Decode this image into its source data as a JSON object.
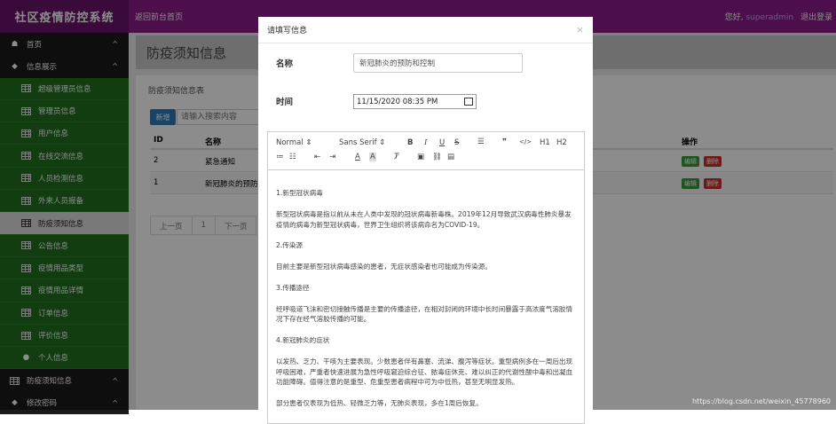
{
  "header": {
    "brand": "社区疫情防控系统",
    "home_link": "返回前台首页",
    "greeting": "您好,",
    "username": "superadmin",
    "logout": "退出登录"
  },
  "sidebar": {
    "items": [
      {
        "label": "首页",
        "type": "group",
        "icon": "home-icon",
        "chevron": "^"
      },
      {
        "label": "信息展示",
        "type": "group",
        "icon": "cubes-icon",
        "chevron": "^"
      },
      {
        "label": "超级管理员信息",
        "type": "sub",
        "icon": "table-icon"
      },
      {
        "label": "管理员信息",
        "type": "sub",
        "icon": "table-icon"
      },
      {
        "label": "用户信息",
        "type": "sub",
        "icon": "table-icon"
      },
      {
        "label": "在线交流信息",
        "type": "sub",
        "icon": "table-icon"
      },
      {
        "label": "人员检测信息",
        "type": "sub",
        "icon": "table-icon"
      },
      {
        "label": "外来人员报备",
        "type": "sub",
        "icon": "table-icon"
      },
      {
        "label": "防疫须知信息",
        "type": "sub",
        "icon": "table-icon",
        "active": true
      },
      {
        "label": "公告信息",
        "type": "sub",
        "icon": "table-icon"
      },
      {
        "label": "疫情用品类型",
        "type": "sub",
        "icon": "table-icon"
      },
      {
        "label": "疫情用品详情",
        "type": "sub",
        "icon": "table-icon"
      },
      {
        "label": "订单信息",
        "type": "sub",
        "icon": "table-icon"
      },
      {
        "label": "评价信息",
        "type": "sub",
        "icon": "table-icon"
      },
      {
        "label": "个人信息",
        "type": "sub",
        "icon": "user-icon"
      },
      {
        "label": "防疫须知信息",
        "type": "group",
        "icon": "table-icon",
        "chevron": "^"
      },
      {
        "label": "修改密码",
        "type": "group",
        "icon": "cubes-icon",
        "chevron": "^"
      }
    ]
  },
  "page": {
    "title": "防疫须知信息",
    "panel_label": "防疫须知信息表",
    "add_label": "新增",
    "search_placeholder": "请输入搜索内容",
    "columns": {
      "id": "ID",
      "name": "名称",
      "ops": "操作"
    },
    "rows": [
      {
        "id": "2",
        "name": "紧急通知",
        "edit": "编辑",
        "del": "删除"
      },
      {
        "id": "1",
        "name": "新冠肺炎的预防",
        "edit": "编辑",
        "del": "删除"
      }
    ],
    "pager": {
      "prev": "上一页",
      "current": "1",
      "next": "下一页"
    }
  },
  "modal": {
    "title": "请填写信息",
    "close": "×",
    "name_label": "名称",
    "name_value": "新冠肺炎的预防和控制",
    "time_label": "时间",
    "time_value": "11/15/2020 08:35 PM",
    "toolbar": {
      "format": "Normal",
      "font": "Sans Serif",
      "h1": "H1",
      "h2": "H2"
    },
    "content": [
      "1.新型冠状病毒",
      "新型冠状病毒是指以前从未在人类中发现的冠状病毒新毒株。2019年12月导致武汉病毒性肺炎暴发疫情的病毒为新型冠状病毒，世界卫生组织将该病命名为COVID-19。",
      "2.传染源",
      "目前主要是新型冠状病毒感染的患者，无症状感染者也可能成为传染源。",
      "3.传播途径",
      "经呼吸道飞沫和密切接触传播是主要的传播途径，在相对封闭的环境中长时间暴露于高浓度气溶胶情况下存在经气溶胶传播的可能。",
      "4.新冠肺炎的症状",
      "以发热、乏力、干咳为主要表现。少数患者伴有鼻塞、流涕、腹泻等症状。重型病例多在一周后出现呼吸困难，严重者快速进展为急性呼吸窘迫综合征、脓毒症休克、难以纠正的代谢性酸中毒和出凝血功能障碍。值得注意的是重型、危重型患者病程中可为中低热，甚至无明显发热。",
      "部分患者仅表现为低热、轻微乏力等，无肺炎表现，多在1周后恢复。"
    ]
  },
  "watermark": "https://blog.csdn.net/weixin_45778960"
}
